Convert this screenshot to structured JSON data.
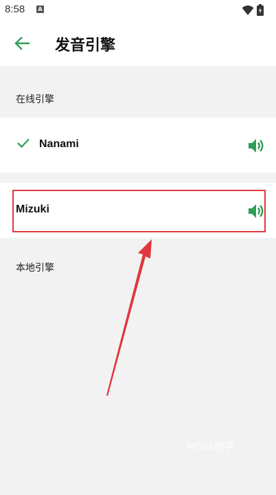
{
  "status_bar": {
    "time": "8:58",
    "notification_letter": "A"
  },
  "app_bar": {
    "title": "发音引擎"
  },
  "sections": {
    "online": {
      "title": "在线引擎"
    },
    "local": {
      "title": "本地引擎"
    }
  },
  "engines": [
    {
      "name": "Nanami",
      "selected": true
    },
    {
      "name": "Mizuki",
      "selected": false
    }
  ],
  "annotation": {
    "highlight_color": "#e0383e",
    "arrow_color": "#e0383e"
  },
  "watermark": {
    "text": "ROM助手"
  },
  "colors": {
    "accent": "#2e9e57",
    "background": "#f2f2f2",
    "surface": "#ffffff"
  },
  "icons": [
    "back-arrow-icon",
    "check-icon",
    "speaker-icon",
    "wifi-icon",
    "battery-icon"
  ]
}
